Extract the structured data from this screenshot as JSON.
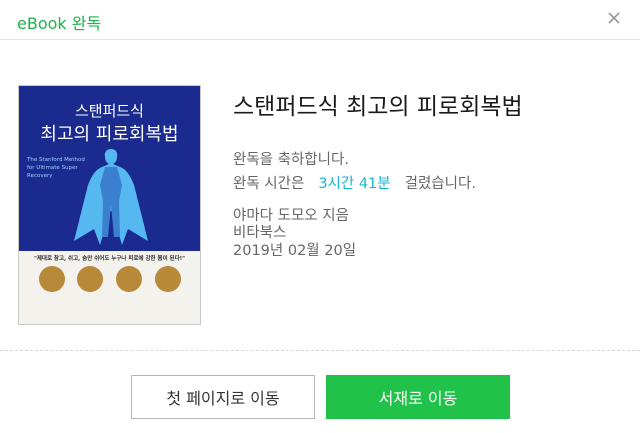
{
  "header": {
    "title": "eBook 완독",
    "close_label": "close"
  },
  "cover": {
    "title_line1": "스탠퍼드식",
    "title_line2": "최고의 피로회복법",
    "english_title": "The Stanford Method for Ultimate Super Recovery",
    "tagline": "\"제대로 참고, 쉬고, 숨만 쉬어도 누구나 피로에 강한 몸이 된다!\""
  },
  "book": {
    "title": "스탠퍼드식 최고의 피로회복법",
    "congrats": "완독을 축하합니다.",
    "time_prefix": "완독 시간은",
    "time_value": "3시간 41분",
    "time_suffix": "걸렸습니다.",
    "author": "야마다 도모오 지음",
    "publisher": "비타북스",
    "date": "2019년 02월 20일"
  },
  "buttons": {
    "first_page": "첫 페이지로 이동",
    "bookshelf": "서재로 이동"
  },
  "colors": {
    "accent_green": "#21c24a",
    "time_highlight": "#19b6d3"
  }
}
